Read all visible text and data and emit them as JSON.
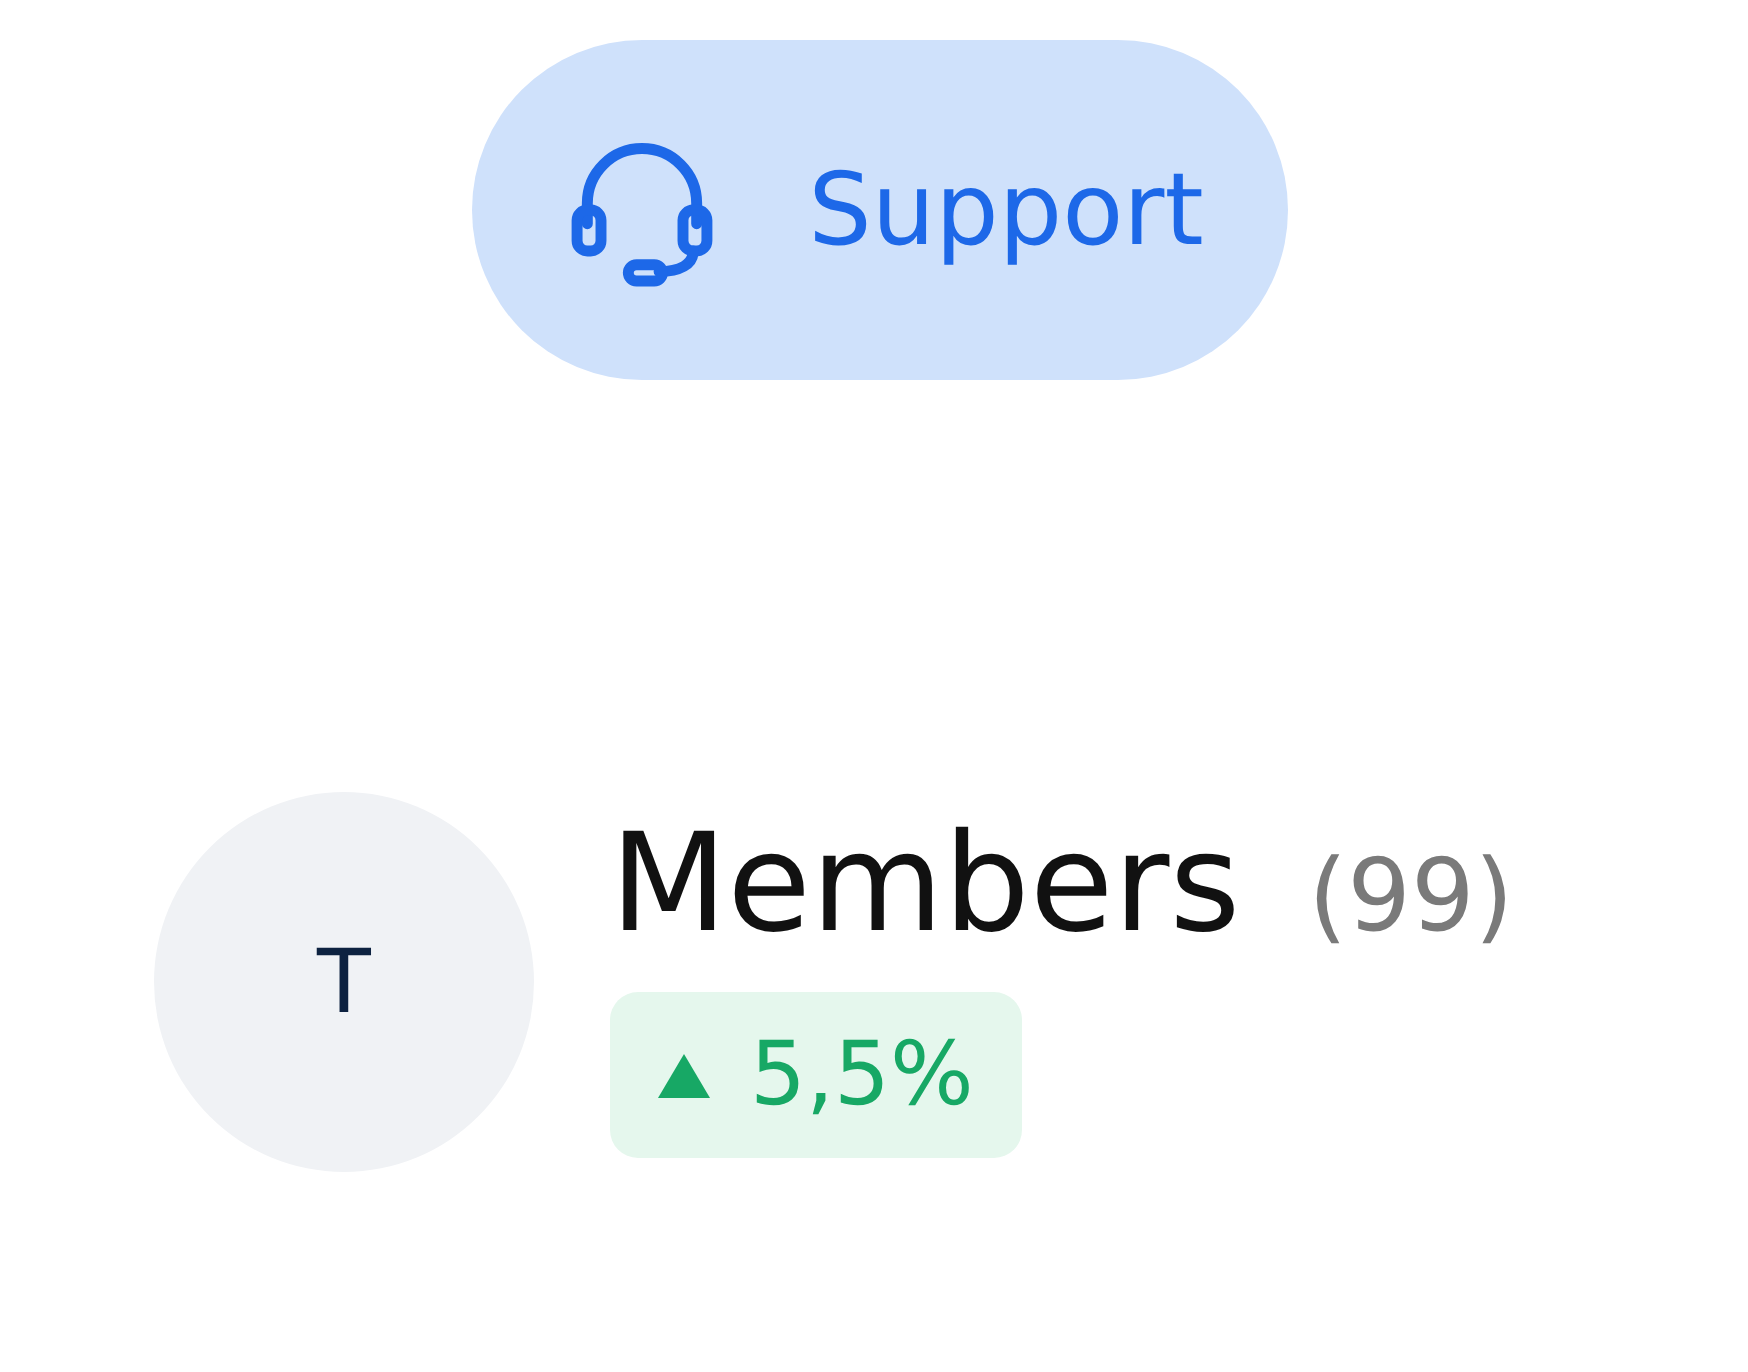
{
  "support_button": {
    "label": "Support"
  },
  "stat": {
    "avatar": "T",
    "title": "Members",
    "count": "(99)",
    "change": {
      "up": true,
      "value": "5,5%"
    }
  }
}
